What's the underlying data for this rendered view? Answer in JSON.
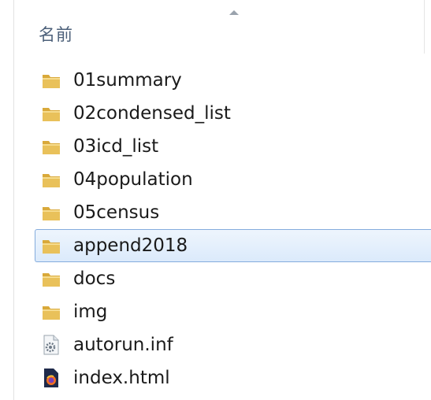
{
  "header": {
    "name_column": "名前"
  },
  "items": [
    {
      "name": "01summary",
      "type": "folder",
      "selected": false
    },
    {
      "name": "02condensed_list",
      "type": "folder",
      "selected": false
    },
    {
      "name": "03icd_list",
      "type": "folder",
      "selected": false
    },
    {
      "name": "04population",
      "type": "folder",
      "selected": false
    },
    {
      "name": "05census",
      "type": "folder",
      "selected": false
    },
    {
      "name": "append2018",
      "type": "folder",
      "selected": true
    },
    {
      "name": "docs",
      "type": "folder",
      "selected": false
    },
    {
      "name": "img",
      "type": "folder",
      "selected": false
    },
    {
      "name": "autorun.inf",
      "type": "settings-file",
      "selected": false
    },
    {
      "name": "index.html",
      "type": "html-file",
      "selected": false
    }
  ],
  "colors": {
    "folder_body": "#e9c15a",
    "folder_tab": "#d9a93a",
    "selection_border": "#84acdd",
    "header_text": "#4c607a"
  }
}
